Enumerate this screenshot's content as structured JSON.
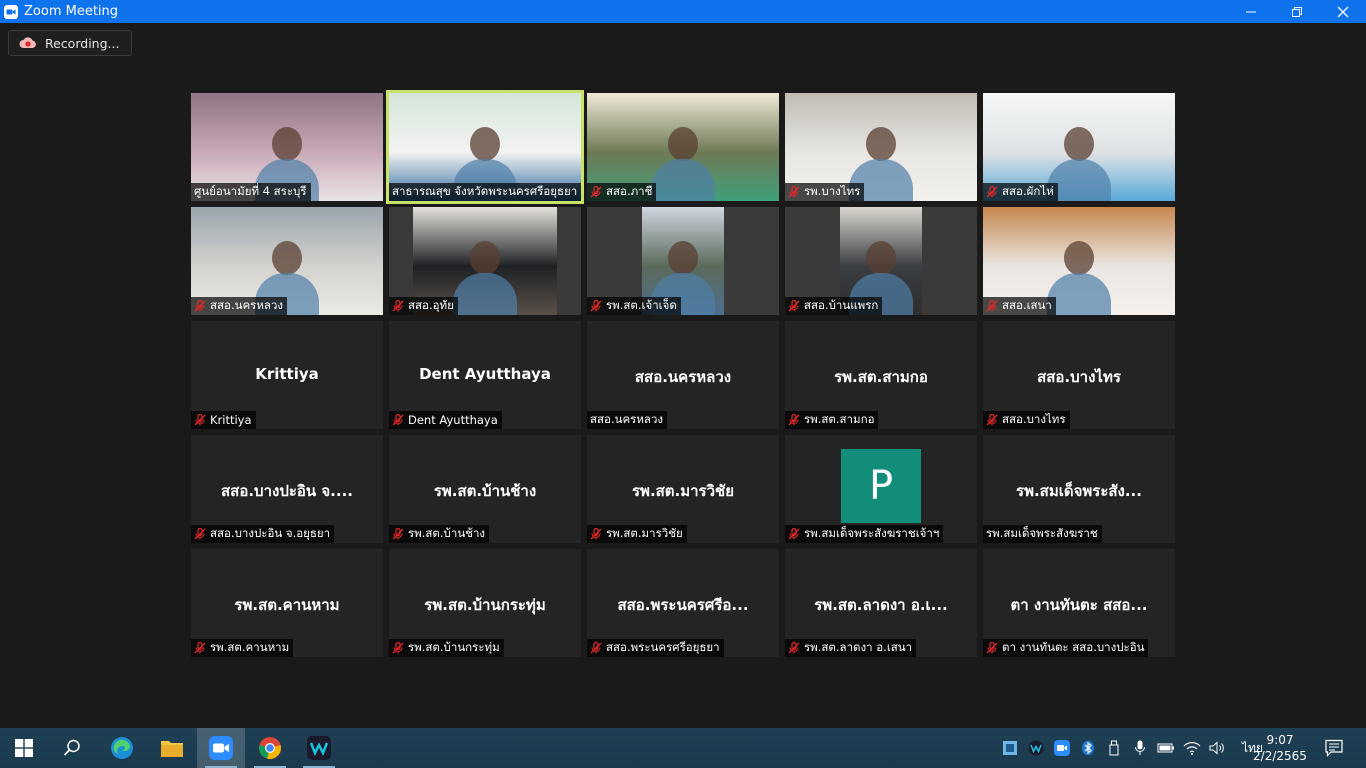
{
  "window": {
    "title": "Zoom Meeting"
  },
  "recording": {
    "label": "Recording..."
  },
  "tiles": [
    {
      "label": "ศูนย์อนามัยที่ 4 สระบุรี",
      "video": true,
      "muted": false
    },
    {
      "label": "สาธารณสุข จังหวัดพระนครศรีอยุธยา",
      "video": true,
      "muted": false,
      "active": true
    },
    {
      "label": "สสอ.ภาชี",
      "video": true,
      "muted": true
    },
    {
      "label": "รพ.บางไทร",
      "video": true,
      "muted": true
    },
    {
      "label": "สสอ.ผักไห่",
      "video": true,
      "muted": true
    },
    {
      "label": "สสอ.นครหลวง",
      "video": true,
      "muted": true
    },
    {
      "label": "สสอ.อุทัย",
      "video": true,
      "muted": true
    },
    {
      "label": "รพ.สต.เจ้าเจ็ด",
      "video": true,
      "muted": true
    },
    {
      "label": "สสอ.บ้านแพรก",
      "video": true,
      "muted": true
    },
    {
      "label": "สสอ.เสนา",
      "video": true,
      "muted": true
    },
    {
      "name": "Krittiya",
      "label": "Krittiya",
      "muted": true
    },
    {
      "name": "Dent Ayutthaya",
      "label": "Dent Ayutthaya",
      "muted": true
    },
    {
      "name": "สสอ.นครหลวง",
      "label": "สสอ.นครหลวง",
      "muted": false
    },
    {
      "name": "รพ.สต.สามกอ",
      "label": "รพ.สต.สามกอ",
      "muted": true
    },
    {
      "name": "สสอ.บางไทร",
      "label": "สสอ.บางไทร",
      "muted": true
    },
    {
      "name": "สสอ.บางปะอิน จ....",
      "label": "สสอ.บางปะอิน จ.อยุธยา",
      "muted": true
    },
    {
      "name": "รพ.สต.บ้านช้าง",
      "label": "รพ.สต.บ้านช้าง",
      "muted": true
    },
    {
      "name": "รพ.สต.มารวิชัย",
      "label": "รพ.สต.มารวิชัย",
      "muted": true
    },
    {
      "avatar": "P",
      "label": "รพ.สมเด็จพระสังฆราชเจ้าฯ",
      "muted": true
    },
    {
      "name": "รพ.สมเด็จพระสัง...",
      "label": "รพ.สมเด็จพระสังฆราช",
      "muted": false
    },
    {
      "name": "รพ.สต.คานหาม",
      "label": "รพ.สต.คานหาม",
      "muted": true
    },
    {
      "name": "รพ.สต.บ้านกระทุ่ม",
      "label": "รพ.สต.บ้านกระทุ่ม",
      "muted": true
    },
    {
      "name": "สสอ.พระนครศรีอ...",
      "label": "สสอ.พระนครศรีอยุธยา",
      "muted": true
    },
    {
      "name": "รพ.สต.ลาดงา อ.เ...",
      "label": "รพ.สต.ลาดงา อ.เสนา",
      "muted": true
    },
    {
      "name": "ตา งานทันตะ สสอ...",
      "label": "ตา งานทันตะ สสอ.บางปะอิน",
      "muted": true
    }
  ],
  "taskbar": {
    "language": "ไทย",
    "time": "9:07",
    "date": "2/2/2565"
  },
  "colors": {
    "titlebar": "#0e72ed",
    "active_border": "#c8e36a",
    "avatar_bg": "#118d7a",
    "muted_icon": "#e02828"
  }
}
